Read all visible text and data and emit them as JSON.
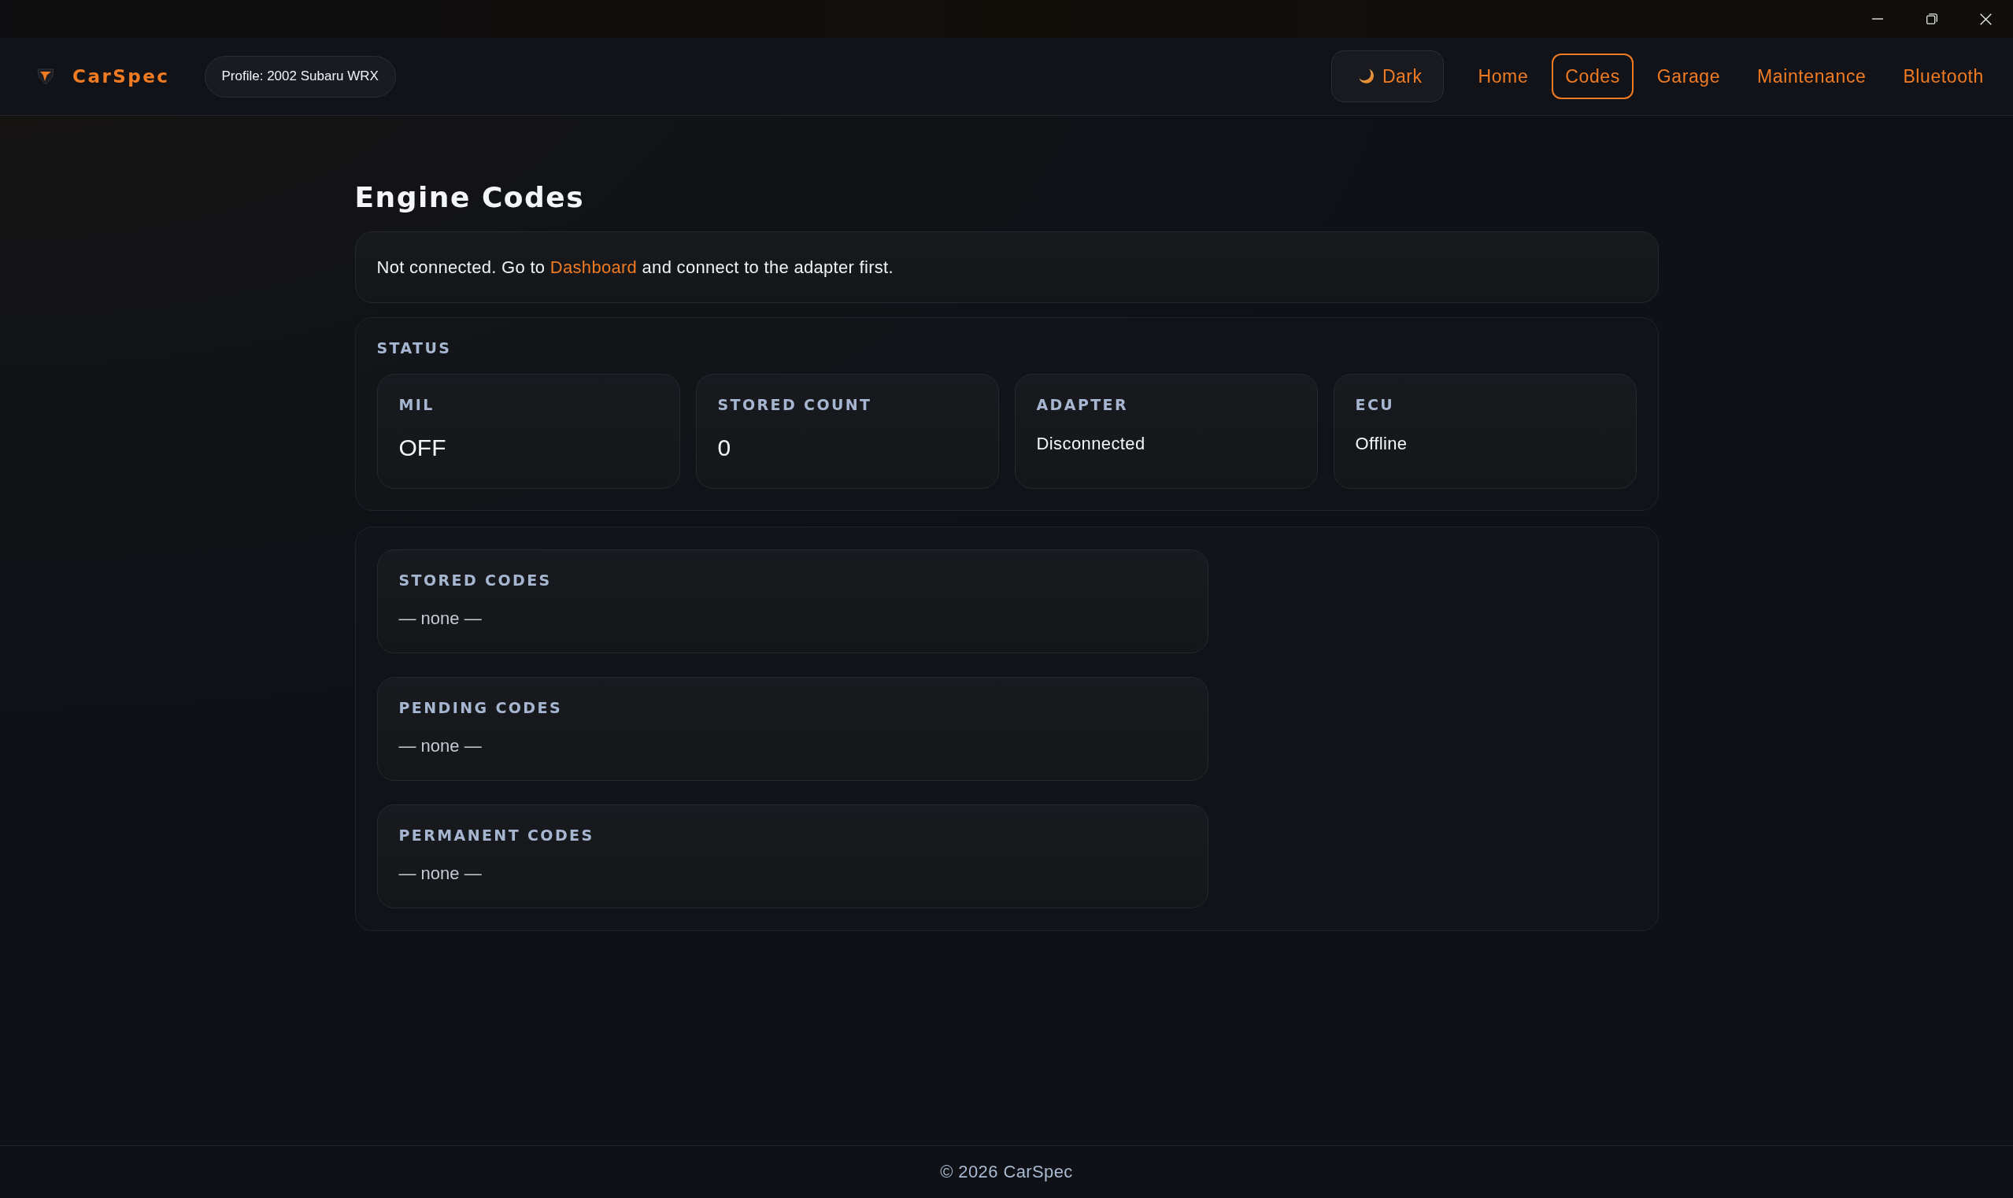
{
  "header": {
    "brand": "CarSpec",
    "profile": "Profile: 2002 Subaru WRX",
    "theme_toggle": {
      "label": "Dark"
    },
    "nav": [
      {
        "label": "Home",
        "selected": false
      },
      {
        "label": "Codes",
        "selected": true
      },
      {
        "label": "Garage",
        "selected": false
      },
      {
        "label": "Maintenance",
        "selected": false
      },
      {
        "label": "Bluetooth",
        "selected": false
      }
    ]
  },
  "page": {
    "title": "Engine Codes"
  },
  "notice": {
    "text_before": "Not connected. Go to",
    "link": "Dashboard",
    "text_after": "and connect to the adapter first."
  },
  "status": {
    "title": "STATUS",
    "cards": [
      {
        "label": "MIL",
        "value": "OFF",
        "kind": "reading"
      },
      {
        "label": "STORED COUNT",
        "value": "0",
        "kind": "reading"
      },
      {
        "label": "ADAPTER",
        "value": "Disconnected",
        "kind": "detail"
      },
      {
        "label": "ECU",
        "value": "Offline",
        "kind": "detail"
      }
    ]
  },
  "code_lists": [
    {
      "title": "STORED CODES",
      "empty_text": "— none —"
    },
    {
      "title": "PENDING CODES",
      "empty_text": "— none —"
    },
    {
      "title": "PERMANENT CODES",
      "empty_text": "— none —"
    }
  ],
  "footer": {
    "text": "© 2026 CarSpec"
  }
}
